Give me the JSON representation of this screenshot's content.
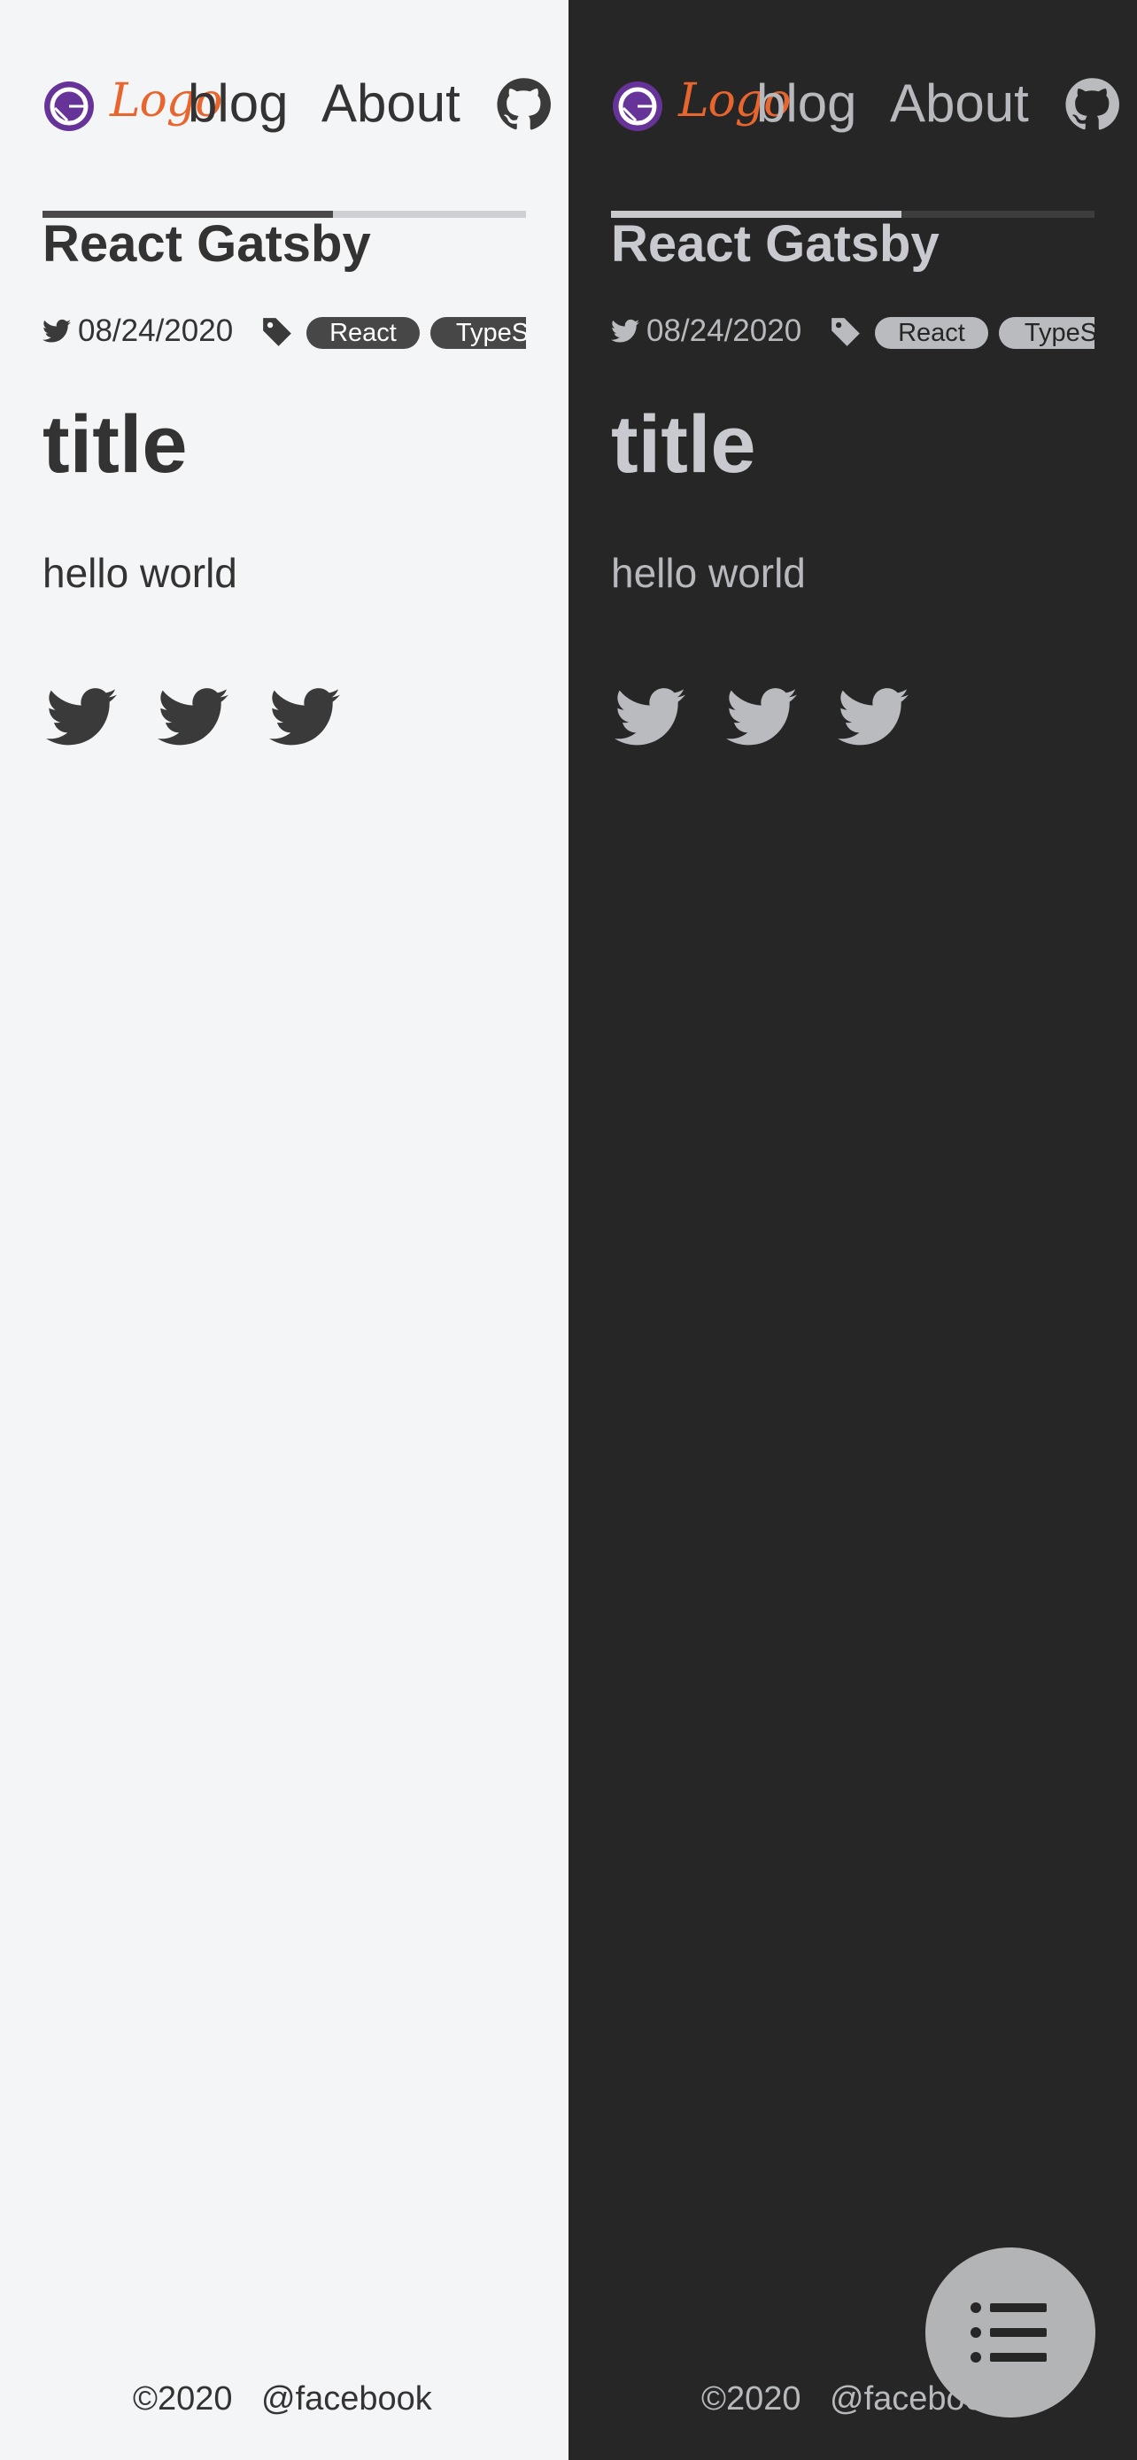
{
  "header": {
    "logo_text": "Logo",
    "nav_blog": "blog",
    "nav_about": "About"
  },
  "post": {
    "title": "React Gatsby",
    "date": "08/24/2020",
    "tags": [
      "React",
      "TypeS"
    ],
    "reading_progress": 0.6
  },
  "content": {
    "heading": "title",
    "body": "hello world"
  },
  "footer": {
    "copyright": "©2020",
    "handle": "@facebook"
  },
  "icons": {
    "brand": "gatsby-icon",
    "repo": "github-icon",
    "date": "twitter-icon",
    "tags": "tag-icon",
    "share": "twitter-icon",
    "toc": "list-icon"
  },
  "colors": {
    "light_bg": "#f4f5f7",
    "dark_bg": "#262626",
    "logo_accent": "#e8652d",
    "gatsby_purple": "#663399"
  }
}
